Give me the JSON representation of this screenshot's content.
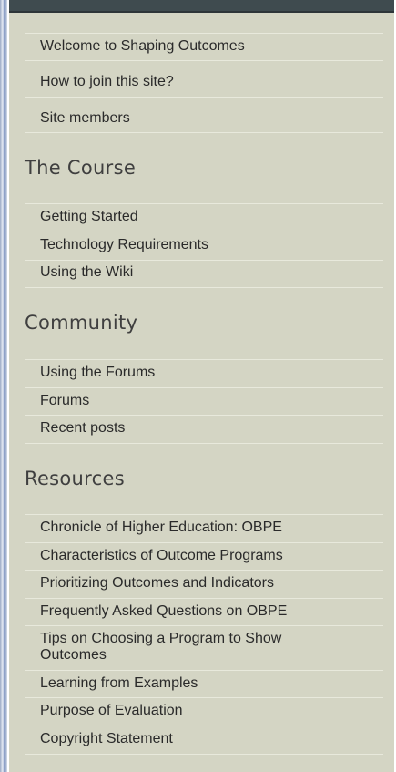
{
  "top_links": [
    "Welcome to Shaping Outcomes",
    "How to join this site?",
    "Site members"
  ],
  "sections": [
    {
      "title": "The Course",
      "items": [
        "Getting Started",
        "Technology Requirements",
        "Using the Wiki"
      ]
    },
    {
      "title": "Community",
      "items": [
        "Using the Forums",
        "Forums",
        "Recent posts"
      ]
    },
    {
      "title": "Resources",
      "items": [
        "Chronicle of Higher Education: OBPE",
        "Characteristics of Outcome Programs",
        "Prioritizing Outcomes and Indicators",
        "Frequently Asked Questions on OBPE",
        "Tips on Choosing a Program to Show Outcomes",
        "Learning from Examples",
        "Purpose of Evaluation",
        "Copyright Statement"
      ]
    }
  ]
}
